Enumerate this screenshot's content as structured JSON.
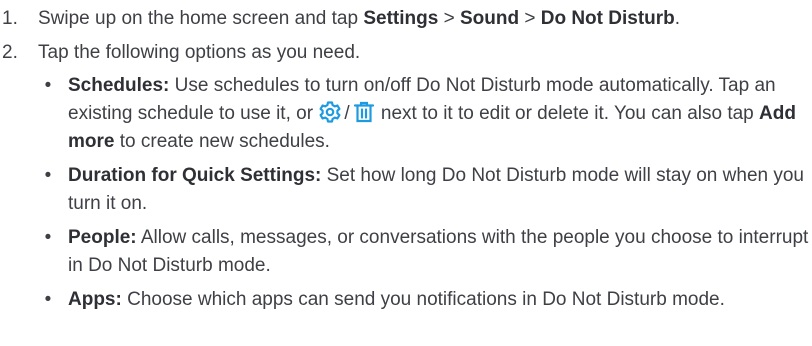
{
  "steps": [
    {
      "number": "1.",
      "text_before": "Swipe up on the home screen and tap ",
      "b1": "Settings",
      "sep1": " > ",
      "b2": "Sound",
      "sep2": " > ",
      "b3": "Do Not Disturb",
      "end": "."
    },
    {
      "number": "2.",
      "text": "Tap the following options as you need."
    }
  ],
  "options": [
    {
      "bullet": "•",
      "label": "Schedules:",
      "text_a": " Use schedules to turn on/off Do Not Disturb mode automatically. Tap an existing schedule to use it, or ",
      "icon_sep": "/",
      "text_b": " next to it to edit or delete it. You can also tap ",
      "bold_add": "Add more",
      "text_c": " to create new schedules.",
      "icons": [
        "gear-icon",
        "trash-icon"
      ]
    },
    {
      "bullet": "•",
      "label": "Duration for Quick Settings:",
      "text": " Set how long Do Not Disturb mode will stay on when you turn it on."
    },
    {
      "bullet": "•",
      "label": "People:",
      "text": " Allow calls, messages, or conversations with the people you choose to interrupt in Do Not Disturb mode."
    },
    {
      "bullet": "•",
      "label": "Apps:",
      "text": " Choose which apps can send you notifications in Do Not Disturb mode."
    }
  ],
  "colors": {
    "text": "#3f4046",
    "icon_accent": "#1e9be0"
  }
}
